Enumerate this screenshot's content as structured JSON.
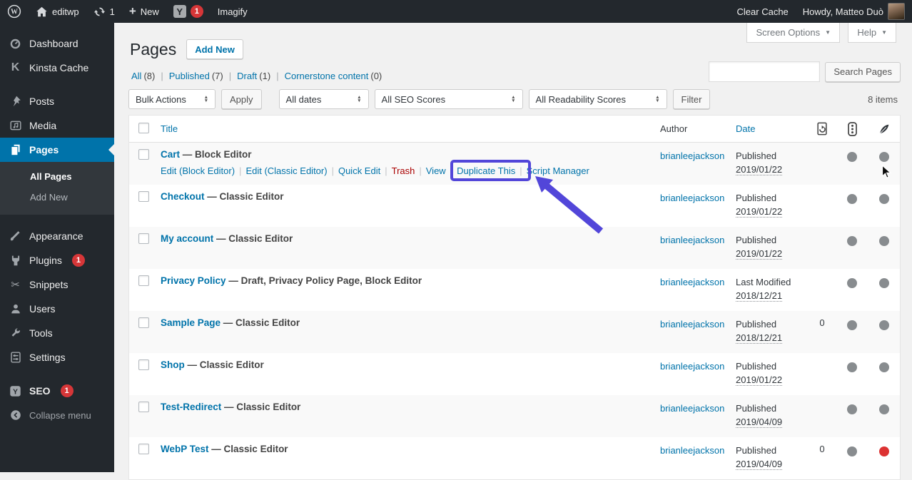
{
  "admin_bar": {
    "site_name": "editwp",
    "updates_count": "1",
    "new_label": "New",
    "yoast_badge": "1",
    "imagify": "Imagify",
    "clear_cache": "Clear Cache",
    "howdy": "Howdy, Matteo Duò"
  },
  "sidebar": {
    "items": [
      {
        "label": "Dashboard"
      },
      {
        "label": "Kinsta Cache"
      },
      {
        "label": "Posts"
      },
      {
        "label": "Media"
      },
      {
        "label": "Pages"
      },
      {
        "label": "Appearance"
      },
      {
        "label": "Plugins",
        "badge": "1"
      },
      {
        "label": "Snippets"
      },
      {
        "label": "Users"
      },
      {
        "label": "Tools"
      },
      {
        "label": "Settings"
      },
      {
        "label": "SEO",
        "badge": "1"
      },
      {
        "label": "Collapse menu"
      }
    ],
    "submenu": [
      {
        "label": "All Pages"
      },
      {
        "label": "Add New"
      }
    ]
  },
  "header": {
    "title": "Pages",
    "add_new": "Add New",
    "screen_options": "Screen Options",
    "help": "Help"
  },
  "views": [
    {
      "label": "All",
      "count": "(8)"
    },
    {
      "label": "Published",
      "count": "(7)"
    },
    {
      "label": "Draft",
      "count": "(1)"
    },
    {
      "label": "Cornerstone content",
      "count": "(0)"
    }
  ],
  "toolbar": {
    "bulk_actions": "Bulk Actions",
    "apply": "Apply",
    "all_dates": "All dates",
    "seo_scores": "All SEO Scores",
    "readability_scores": "All Readability Scores",
    "filter": "Filter",
    "item_count": "8 items",
    "search_button": "Search Pages",
    "search_value": ""
  },
  "table": {
    "columns": {
      "title": "Title",
      "author": "Author",
      "date": "Date"
    },
    "rows": [
      {
        "title": "Cart",
        "suffix": " — Block Editor",
        "author": "brianleejackson",
        "status": "Published",
        "date": "2019/01/22",
        "redirects": "",
        "seo_dot": "gray",
        "readability_dot": "gray",
        "actions": [
          "Edit (Block Editor)",
          "Edit (Classic Editor)",
          "Quick Edit",
          "Trash",
          "View",
          "Duplicate This",
          "Script Manager"
        ]
      },
      {
        "title": "Checkout",
        "suffix": " — Classic Editor",
        "author": "brianleejackson",
        "status": "Published",
        "date": "2019/01/22",
        "redirects": "",
        "seo_dot": "gray",
        "readability_dot": "gray"
      },
      {
        "title": "My account",
        "suffix": " — Classic Editor",
        "author": "brianleejackson",
        "status": "Published",
        "date": "2019/01/22",
        "redirects": "",
        "seo_dot": "gray",
        "readability_dot": "gray"
      },
      {
        "title": "Privacy Policy",
        "suffix": " — Draft, Privacy Policy Page, Block Editor",
        "author": "brianleejackson",
        "status": "Last Modified",
        "date": "2018/12/21",
        "redirects": "",
        "seo_dot": "gray",
        "readability_dot": "gray"
      },
      {
        "title": "Sample Page",
        "suffix": " — Classic Editor",
        "author": "brianleejackson",
        "status": "Published",
        "date": "2018/12/21",
        "redirects": "0",
        "seo_dot": "gray",
        "readability_dot": "gray"
      },
      {
        "title": "Shop",
        "suffix": " — Classic Editor",
        "author": "brianleejackson",
        "status": "Published",
        "date": "2019/01/22",
        "redirects": "",
        "seo_dot": "gray",
        "readability_dot": "gray"
      },
      {
        "title": "Test-Redirect",
        "suffix": " — Classic Editor",
        "author": "brianleejackson",
        "status": "Published",
        "date": "2019/04/09",
        "redirects": "",
        "seo_dot": "gray",
        "readability_dot": "gray"
      },
      {
        "title": "WebP Test",
        "suffix": " — Classic Editor",
        "author": "brianleejackson",
        "status": "Published",
        "date": "2019/04/09",
        "redirects": "0",
        "seo_dot": "gray",
        "readability_dot": "red"
      }
    ]
  },
  "colors": {
    "gray": "#888c8f",
    "red": "#dc3232",
    "accent": "#0073aa",
    "annotation": "#5246d9",
    "active_menu": "#0073aa",
    "admin_bar_bg": "#23282d"
  }
}
